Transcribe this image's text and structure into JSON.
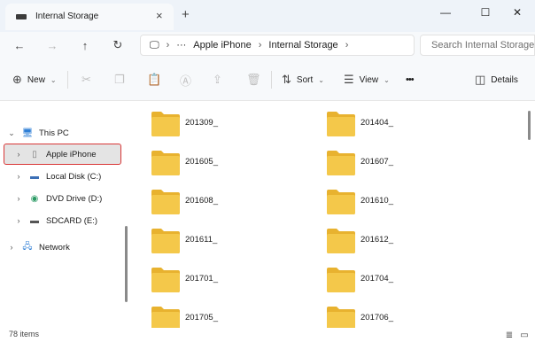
{
  "tab": {
    "title": "Internal Storage",
    "close": "×",
    "new_tab": "+"
  },
  "window": {
    "minimize": "—",
    "maximize": "☐",
    "close": "✕"
  },
  "nav": {
    "back": "←",
    "forward": "→",
    "up": "↑",
    "refresh": "↻",
    "address": {
      "pc_icon": "🖵",
      "chev1": "›",
      "ellipsis": "···",
      "seg1": "Apple iPhone",
      "chev2": "›",
      "seg2": "Internal Storage",
      "chev3": "›"
    },
    "search_placeholder": "Search Internal Storage"
  },
  "toolbar": {
    "new_label": "New",
    "sort_label": "Sort",
    "view_label": "View",
    "more": "•••",
    "details_label": "Details"
  },
  "sidebar": {
    "this_pc": "This PC",
    "items": [
      {
        "label": "Apple iPhone"
      },
      {
        "label": "Local Disk (C:)"
      },
      {
        "label": "DVD Drive (D:)"
      },
      {
        "label": "SDCARD (E:)"
      }
    ],
    "network": "Network"
  },
  "folders": [
    {
      "name": "201309_"
    },
    {
      "name": "201404_"
    },
    {
      "name": "201605_"
    },
    {
      "name": "201607_"
    },
    {
      "name": "201608_"
    },
    {
      "name": "201610_"
    },
    {
      "name": "201611_"
    },
    {
      "name": "201612_"
    },
    {
      "name": "201701_"
    },
    {
      "name": "201704_"
    },
    {
      "name": "201705_"
    },
    {
      "name": "201706_"
    }
  ],
  "status": {
    "count": "78 items"
  },
  "colors": {
    "accent_selection_border": "#d93636",
    "folder": "#f4c84a",
    "folder_dark": "#e8b22f"
  }
}
